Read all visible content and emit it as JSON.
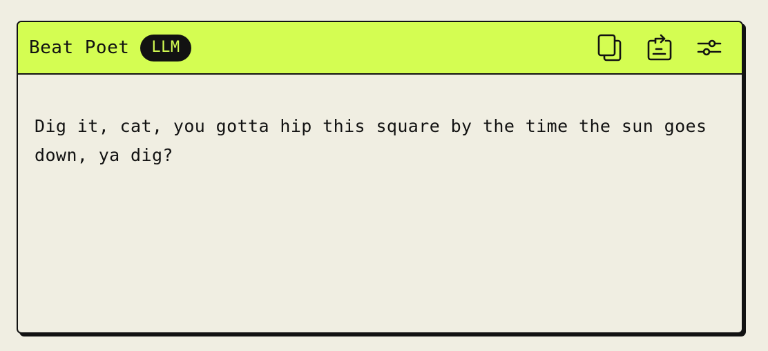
{
  "card": {
    "title": "Beat Poet",
    "badge": "LLM",
    "message": "Dig it, cat, you gotta hip this square by the time the sun goes down, ya dig?"
  },
  "toolbar": {
    "icons": [
      "copy-icon",
      "transfer-icon",
      "settings-sliders-icon"
    ]
  },
  "colors": {
    "background": "#f0eee2",
    "header": "#d4fd52",
    "ink": "#121212"
  }
}
